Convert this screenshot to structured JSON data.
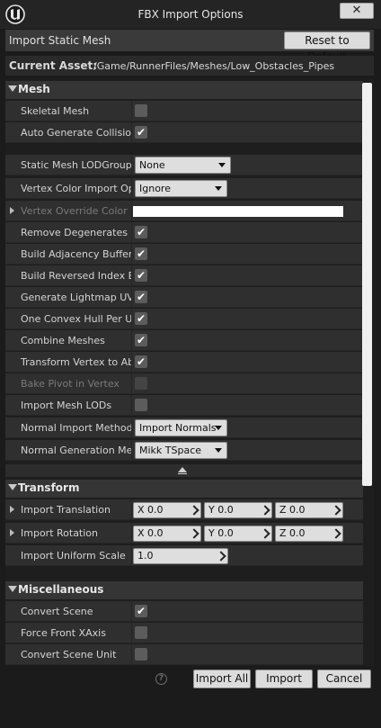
{
  "window": {
    "title": "FBX Import Options",
    "close_glyph": "✕"
  },
  "header": {
    "import_label": "Import Static Mesh",
    "reset_button": "Reset to Default"
  },
  "asset": {
    "label": "Current Asset:",
    "path": "/Game/RunnerFiles/Meshes/Low_Obstacles_Pipes"
  },
  "mesh": {
    "label": "Mesh",
    "skeletal_mesh": {
      "label": "Skeletal Mesh",
      "checked": false
    },
    "auto_generate_collision": {
      "label": "Auto Generate Collision",
      "checked": true
    },
    "lod_group": {
      "label": "Static Mesh LODGroup",
      "value": "None"
    },
    "vertex_color_import": {
      "label": "Vertex Color Import Opti",
      "value": "Ignore"
    },
    "vertex_override_color": {
      "label": "Vertex Override Color",
      "color": "#ffffff"
    },
    "remove_degenerates": {
      "label": "Remove Degenerates",
      "checked": true
    },
    "build_adjacency": {
      "label": "Build Adjacency Buffer",
      "checked": true
    },
    "build_reversed_index": {
      "label": "Build Reversed Index Bu",
      "checked": true
    },
    "generate_lightmap_uvs": {
      "label": "Generate Lightmap UVs",
      "checked": true
    },
    "one_convex_hull": {
      "label": "One Convex Hull Per UCX",
      "checked": true
    },
    "combine_meshes": {
      "label": "Combine Meshes",
      "checked": true
    },
    "transform_vertex": {
      "label": "Transform Vertex to Abs",
      "checked": true
    },
    "bake_pivot": {
      "label": "Bake Pivot in Vertex",
      "checked": false
    },
    "import_mesh_lods": {
      "label": "Import Mesh LODs",
      "checked": false
    },
    "normal_import_method": {
      "label": "Normal Import Method",
      "value": "Import Normals"
    },
    "normal_generation_method": {
      "label": "Normal Generation Meth",
      "value": "Mikk TSpace"
    }
  },
  "transform": {
    "label": "Transform",
    "import_translation": {
      "label": "Import Translation",
      "x": "X  0.0",
      "y": "Y  0.0",
      "z": "Z  0.0"
    },
    "import_rotation": {
      "label": "Import Rotation",
      "x": "X  0.0",
      "y": "Y  0.0",
      "z": "Z  0.0"
    },
    "import_uniform_scale": {
      "label": "Import Uniform Scale",
      "value": "1.0"
    }
  },
  "misc": {
    "label": "Miscellaneous",
    "convert_scene": {
      "label": "Convert Scene",
      "checked": true
    },
    "force_front_xaxis": {
      "label": "Force Front XAxis",
      "checked": false
    },
    "convert_scene_unit": {
      "label": "Convert Scene Unit",
      "checked": false
    }
  },
  "footer": {
    "help_glyph": "?",
    "import_all": "Import All",
    "import": "Import",
    "cancel": "Cancel"
  },
  "colors": {
    "panel_bg": "#1e1e1e",
    "row_bg": "#2f2f2f",
    "category_bg": "#353535",
    "button_bg": "#dcdcdc"
  },
  "icons": {
    "logo": "unreal-logo-icon",
    "close": "close-icon",
    "help": "help-icon",
    "checkmark": "checkmark-icon"
  }
}
